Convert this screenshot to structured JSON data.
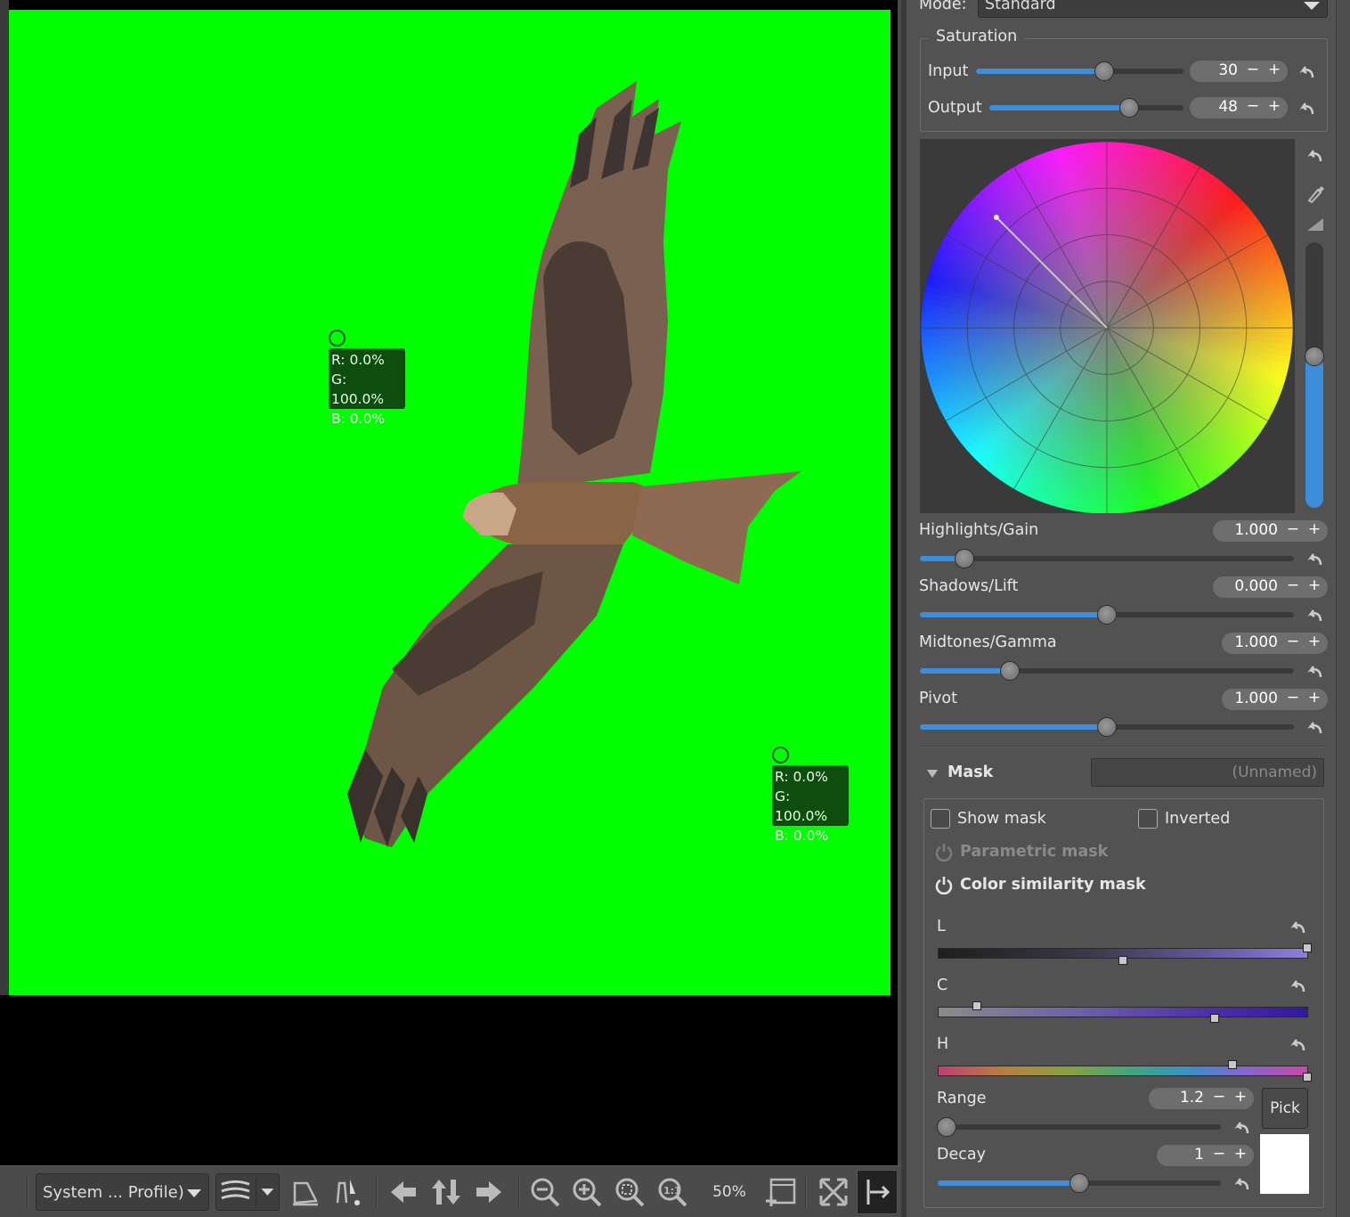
{
  "viewer": {
    "background_color": "#00ff00",
    "samplers": [
      {
        "r": "R: 0.0%",
        "g": "G: 100.0%",
        "b": "B: 0.0%"
      },
      {
        "r": "R: 0.0%",
        "g": "G: 100.0%",
        "b": "B: 0.0%"
      }
    ]
  },
  "toolbar": {
    "profile": "System ... Profile)",
    "zoom": "50%",
    "icons": [
      "soft-proof-icon",
      "gamut-check-icon",
      "before-after-icon",
      "previous-image-icon",
      "sync-icon",
      "next-image-icon",
      "zoom-out-icon",
      "zoom-in-icon",
      "zoom-fit-icon",
      "zoom-100-icon",
      "new-detail-window-icon",
      "fullscreen-icon",
      "toggle-panel-icon"
    ]
  },
  "panel": {
    "mode_label": "Mode:",
    "mode_value": "Standard",
    "saturation": {
      "title": "Saturation",
      "input": {
        "label": "Input",
        "value": "30",
        "level": 0.62
      },
      "output": {
        "label": "Output",
        "value": "48",
        "level": 0.72
      }
    },
    "wheel": {
      "point_angle_deg": 135,
      "point_radius": 0.84,
      "vertical_level": 0.57
    },
    "sliders": [
      {
        "label": "Highlights/Gain",
        "value": "1.000",
        "level": 0.12
      },
      {
        "label": "Shadows/Lift",
        "value": "0.000",
        "level": 0.5
      },
      {
        "label": "Midtones/Gamma",
        "value": "1.000",
        "level": 0.24
      },
      {
        "label": "Pivot",
        "value": "1.000",
        "level": 0.5
      }
    ],
    "mask": {
      "title": "Mask",
      "name_placeholder": "(Unnamed)",
      "show_mask": "Show mask",
      "inverted": "Inverted",
      "parametric": "Parametric mask",
      "color_similarity": "Color similarity mask",
      "L": {
        "label": "L"
      },
      "C": {
        "label": "C"
      },
      "H": {
        "label": "H"
      },
      "range": {
        "label": "Range",
        "value": "1.2",
        "level": 0.03
      },
      "decay": {
        "label": "Decay",
        "value": "1",
        "level": 0.5
      },
      "pick": "Pick",
      "minus": "−",
      "plus": "+"
    }
  }
}
